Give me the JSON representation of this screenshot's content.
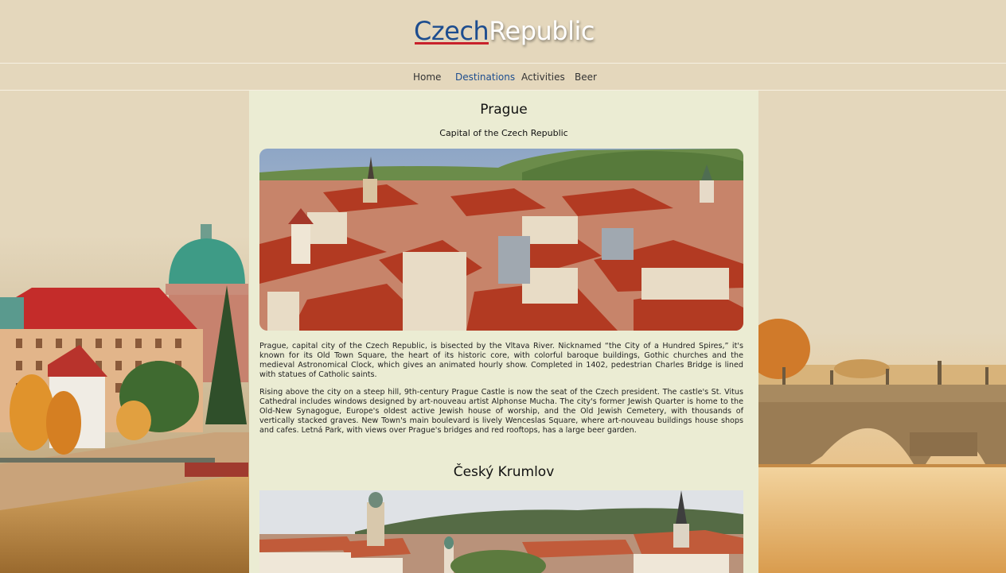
{
  "header": {
    "logo_part1": "Czech",
    "logo_part2": "Republic"
  },
  "nav": {
    "items": [
      {
        "label": "Home"
      },
      {
        "label": "Destinations"
      },
      {
        "label": "Activities"
      },
      {
        "label": "Beer"
      }
    ],
    "active": "Destinations"
  },
  "main": {
    "destinations": [
      {
        "title": "Prague",
        "subtitle": "Capital of the Czech Republic",
        "paragraphs": [
          "Prague, capital city of the Czech Republic, is bisected by the Vltava River. Nicknamed “the City of a Hundred Spires,” it's known for its Old Town Square, the heart of its historic core, with colorful baroque buildings, Gothic churches and the medieval Astronomical Clock, which gives an animated hourly show. Completed in 1402, pedestrian Charles Bridge is lined with statues of Catholic saints.",
          "Rising above the city on a steep hill, 9th-century Prague Castle is now the seat of the Czech president. The castle's St. Vitus Cathedral includes windows designed by art-nouveau artist Alphonse Mucha. The city's former Jewish Quarter is home to the Old-New Synagogue, Europe's oldest active Jewish house of worship, and the Old Jewish Cemetery, with thousands of vertically stacked graves. New Town's main boulevard is lively Wenceslas Square, where art-nouveau buildings house shops and cafes. Letná Park, with views over Prague's bridges and red rooftops, has a large beer garden."
        ]
      },
      {
        "title": "Český Krumlov"
      }
    ]
  },
  "colors": {
    "background": "#e4d7bc",
    "content_background": "#ebecd3",
    "logo_blue": "#1d4d8f",
    "logo_red": "#c8212b",
    "nav_active": "#1d4d8f"
  }
}
